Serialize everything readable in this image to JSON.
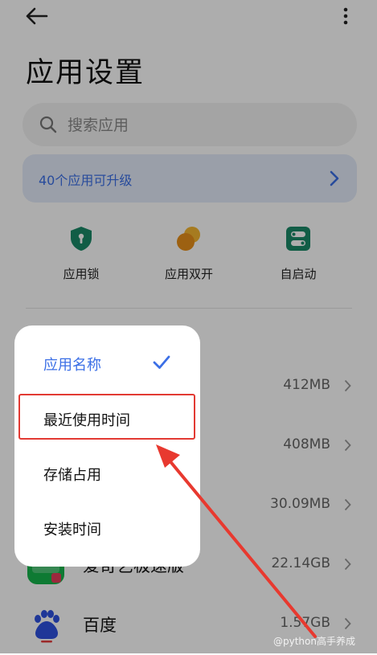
{
  "header": {
    "title": "应用设置"
  },
  "search": {
    "placeholder": "搜索应用"
  },
  "banner": {
    "text": "40个应用可升级"
  },
  "quick_actions": [
    {
      "label": "应用锁",
      "icon": "shield-lock-icon",
      "color": "#1a8a68"
    },
    {
      "label": "应用双开",
      "icon": "dual-circle-icon",
      "color": "#f0a01c"
    },
    {
      "label": "自启动",
      "icon": "toggle-switch-icon",
      "color": "#1a8a68"
    }
  ],
  "apps": [
    {
      "name": "",
      "size": "412MB"
    },
    {
      "name": "",
      "size": "408MB"
    },
    {
      "name": "",
      "size": "30.09MB"
    },
    {
      "name": "爱奇艺极速版",
      "size": "22.14GB"
    },
    {
      "name": "百度",
      "size": "1.57GB"
    }
  ],
  "sort_menu": {
    "items": [
      {
        "label": "应用名称",
        "selected": true
      },
      {
        "label": "最近使用时间",
        "selected": false
      },
      {
        "label": "存储占用",
        "selected": false
      },
      {
        "label": "安装时间",
        "selected": false
      }
    ]
  },
  "watermark": "@python高手养成",
  "colors": {
    "accent": "#3b6fe6",
    "annotation": "#e23a33"
  }
}
